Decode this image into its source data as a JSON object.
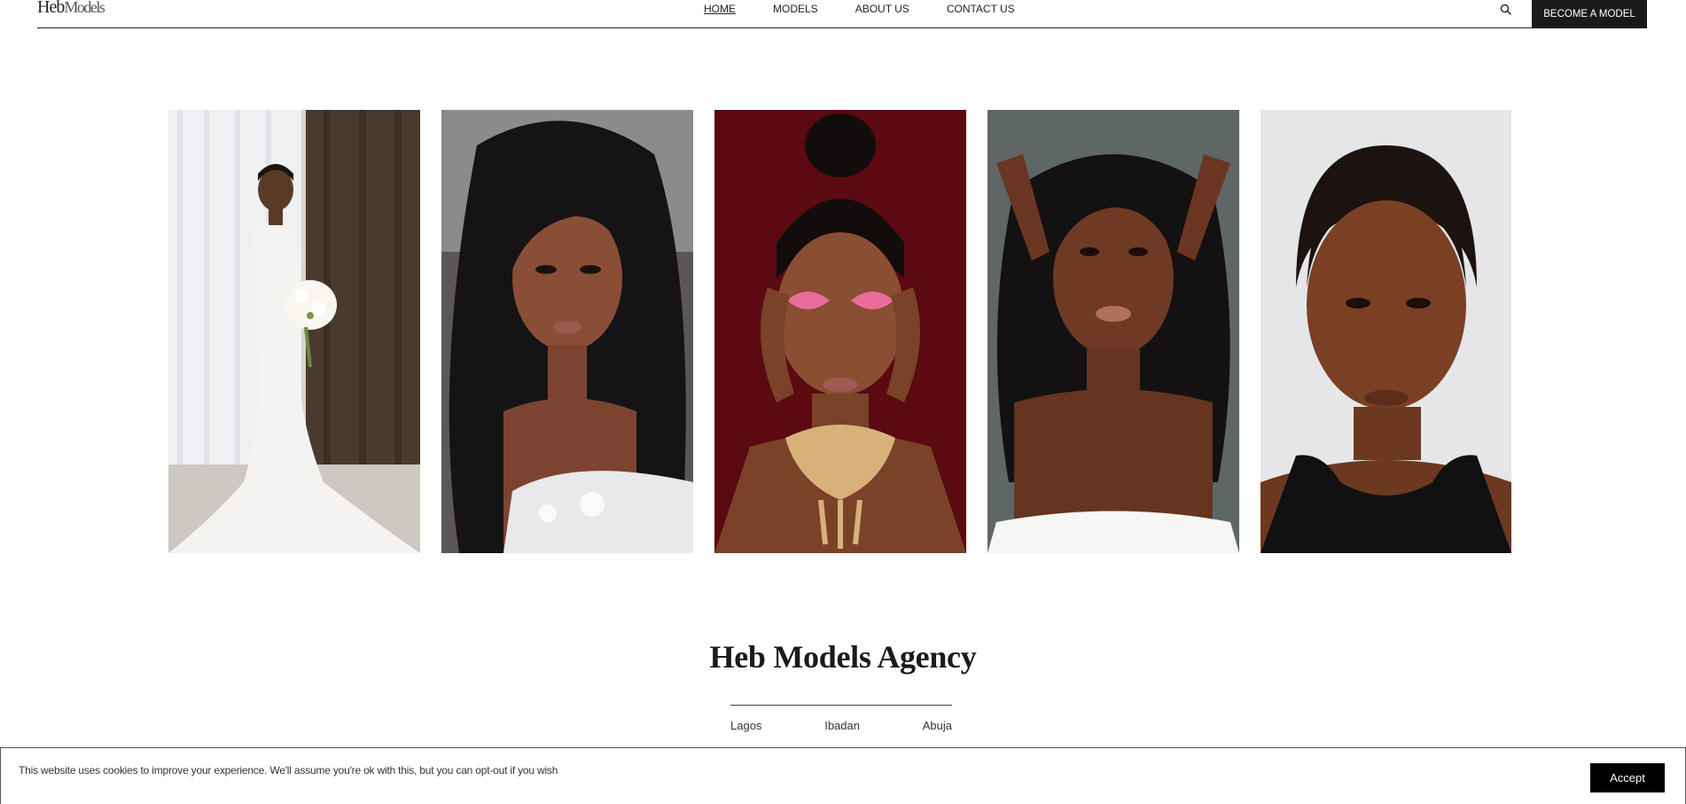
{
  "header": {
    "logo": {
      "main": "Heb",
      "sub": "Models"
    },
    "nav": [
      {
        "label": "HOME",
        "active": true
      },
      {
        "label": "MODELS",
        "active": false
      },
      {
        "label": "ABOUT US",
        "active": false
      },
      {
        "label": "CONTACT US",
        "active": false
      }
    ],
    "search_icon": "search-icon",
    "cta_label": "BECOME A MODEL"
  },
  "gallery": {
    "photos": [
      {
        "subject": "bride-in-white-gown",
        "bg": "#cfc9c1"
      },
      {
        "subject": "model-long-wavy-hair",
        "bg": "#3a3535"
      },
      {
        "subject": "model-pink-eyeshadow-necklace",
        "bg": "#6e0f14"
      },
      {
        "subject": "model-strapless-white",
        "bg": "#5e6464"
      },
      {
        "subject": "model-black-tank-top",
        "bg": "#e8e8ea"
      }
    ]
  },
  "agency": {
    "title": "Heb Models Agency",
    "locations": [
      "Lagos",
      "Ibadan",
      "Abuja"
    ]
  },
  "cookie": {
    "text": "This website uses cookies to improve your experience. We'll assume you're ok with this, but you can opt-out if you wish",
    "accept_label": "Accept"
  },
  "colors": {
    "dark": "#1a1a1a",
    "background": "#ffffff"
  }
}
